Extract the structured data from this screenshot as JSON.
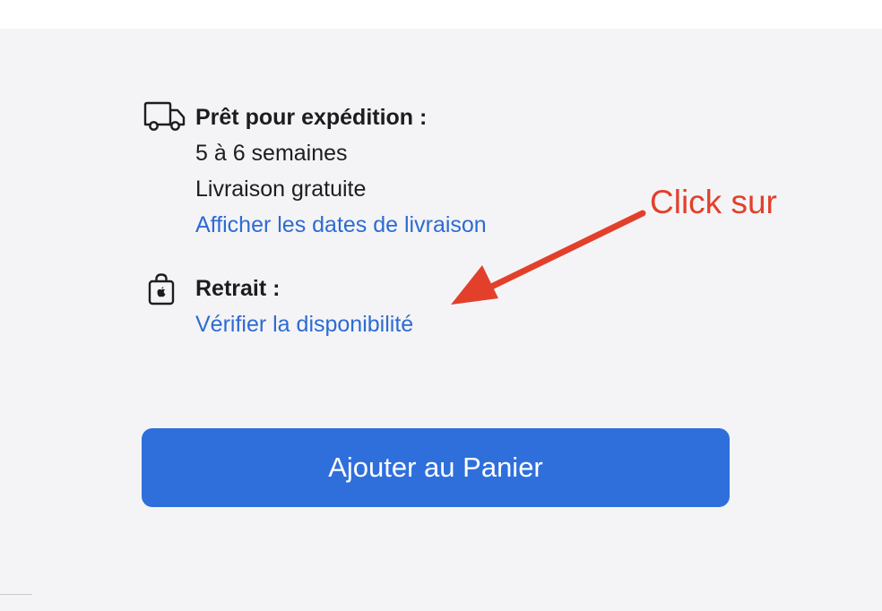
{
  "shipping": {
    "icon": "truck-icon",
    "heading": "Prêt pour expédition :",
    "delay": "5 à 6 semaines",
    "cost": "Livraison gratuite",
    "link": "Afficher les dates de livraison"
  },
  "pickup": {
    "icon": "apple-bag-icon",
    "heading": "Retrait :",
    "link": "Vérifier la disponibilité"
  },
  "cta": {
    "label": "Ajouter au Panier"
  },
  "annotation": {
    "text": "Click sur",
    "color": "#e2402b"
  },
  "colors": {
    "link": "#2d6bd2",
    "button": "#2f6fdc",
    "panel_background": "#f4f4f6"
  }
}
